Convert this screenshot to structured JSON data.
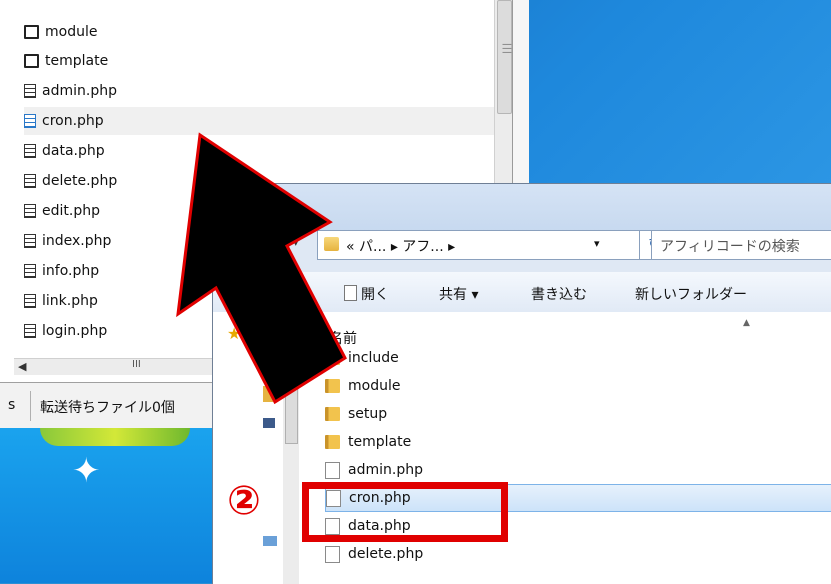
{
  "ftp_tree": {
    "items": [
      {
        "label": "module",
        "type": "folder",
        "highlighted": false
      },
      {
        "label": "template",
        "type": "folder",
        "highlighted": false
      },
      {
        "label": "admin.php",
        "type": "file",
        "highlighted": false
      },
      {
        "label": "cron.php",
        "type": "file",
        "highlighted": true
      },
      {
        "label": "data.php",
        "type": "file",
        "highlighted": false
      },
      {
        "label": "delete.php",
        "type": "file",
        "highlighted": false
      },
      {
        "label": "edit.php",
        "type": "file",
        "highlighted": false
      },
      {
        "label": "index.php",
        "type": "file",
        "highlighted": false
      },
      {
        "label": "info.php",
        "type": "file",
        "highlighted": false
      },
      {
        "label": "link.php",
        "type": "file",
        "highlighted": false
      },
      {
        "label": "login.php",
        "type": "file",
        "highlighted": false
      }
    ]
  },
  "ftp_status": {
    "left_fragment": "s",
    "queue_text": "転送待ちファイル0個"
  },
  "explorer": {
    "address": {
      "crumb": "« パ... ▸ アフ... ▸"
    },
    "search_placeholder": "アフィリコードの検索",
    "toolbar": {
      "open": "開く",
      "share": "共有 ▾",
      "burn": "書き込む",
      "new_folder": "新しいフォルダー"
    },
    "column_name": "名前",
    "files": [
      {
        "label": "include",
        "type": "folder",
        "selected": false
      },
      {
        "label": "module",
        "type": "folder",
        "selected": false
      },
      {
        "label": "setup",
        "type": "folder",
        "selected": false
      },
      {
        "label": "template",
        "type": "folder",
        "selected": false
      },
      {
        "label": "admin.php",
        "type": "file",
        "selected": false
      },
      {
        "label": "cron.php",
        "type": "file",
        "selected": true
      },
      {
        "label": "data.php",
        "type": "file",
        "selected": false
      },
      {
        "label": "delete.php",
        "type": "file",
        "selected": false
      }
    ]
  },
  "annotation": {
    "step_marker": "②",
    "colors": {
      "highlight": "#e00000",
      "arrow": "#000000"
    }
  }
}
